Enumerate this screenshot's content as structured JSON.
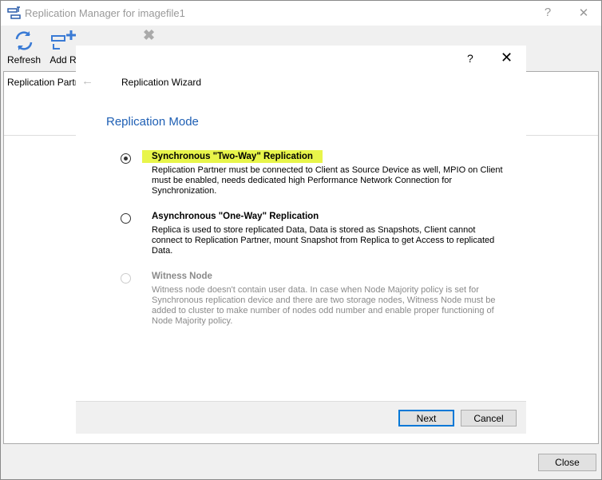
{
  "window": {
    "title": "Replication Manager for imagefile1",
    "help": "?",
    "close": "✕"
  },
  "toolbar": {
    "refresh": "Refresh",
    "add": "Add R"
  },
  "grid": {
    "header": "Replication Partn"
  },
  "main": {
    "close_label": "Close"
  },
  "dialog": {
    "help": "?",
    "close": "✕",
    "back": "←",
    "title": "Replication Wizard",
    "heading": "Replication Mode",
    "options": [
      {
        "title": "Synchronous \"Two-Way\" Replication",
        "desc": "Replication Partner must be connected to Client as Source Device as well, MPIO on Client must be enabled, needs dedicated high Performance Network Connection for Synchronization.",
        "selected": true,
        "enabled": true
      },
      {
        "title": "Asynchronous \"One-Way\" Replication",
        "desc": "Replica is used to store replicated Data, Data is stored as Snapshots, Client cannot connect to Replication Partner, mount Snapshot from Replica to get Access to replicated Data.",
        "selected": false,
        "enabled": true
      },
      {
        "title": "Witness Node",
        "desc": "Witness node doesn't contain user data. In case when Node Majority policy is set for Synchronous replication device and there are two storage nodes, Witness Node must be added to cluster to make number of nodes odd number and enable proper functioning of Node Majority policy.",
        "selected": false,
        "enabled": false
      }
    ],
    "next": "Next",
    "cancel": "Cancel"
  },
  "colors": {
    "accent": "#1e5fb4",
    "highlight": "#e8f54a",
    "focus": "#0078d7"
  }
}
